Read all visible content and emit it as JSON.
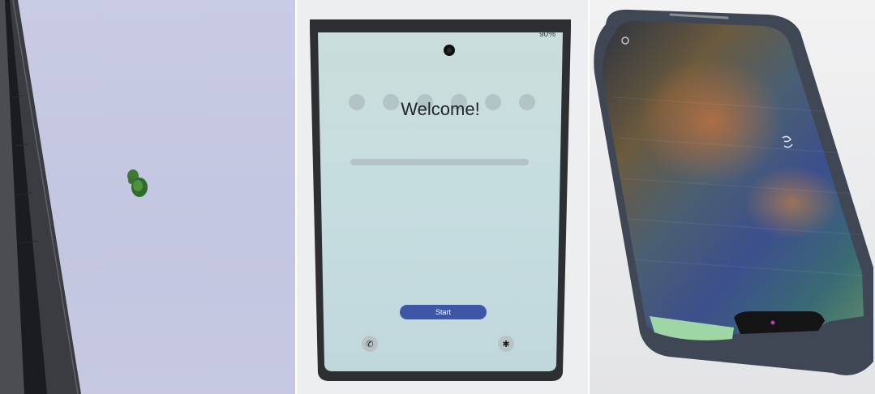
{
  "panel2": {
    "status_text": "90%",
    "welcome_text": "Welcome!",
    "start_label": "Start",
    "call_icon": "phone-icon",
    "accessibility_icon": "accessibility-icon"
  }
}
